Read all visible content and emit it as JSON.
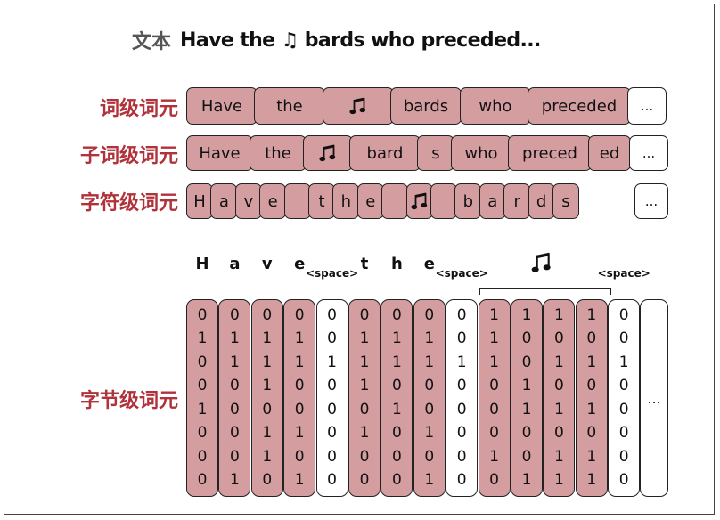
{
  "title": {
    "label": "文本",
    "text": "Have the ♫ bards who preceded..."
  },
  "colors": {
    "token_fill": "#d49ea1",
    "label_red": "#b0323a",
    "white": "#ffffff",
    "border": "#222222"
  },
  "rows": {
    "word": {
      "label": "词级词元",
      "tokens": [
        {
          "text": "Have"
        },
        {
          "text": "the"
        },
        {
          "text": "♫",
          "icon": "music-note-icon"
        },
        {
          "text": "bards"
        },
        {
          "text": "who"
        },
        {
          "text": "preceded"
        },
        {
          "text": "...",
          "white": true
        }
      ]
    },
    "subword": {
      "label": "子词级词元",
      "tokens": [
        {
          "text": "Have"
        },
        {
          "text": "the"
        },
        {
          "text": "♫",
          "icon": "music-note-icon"
        },
        {
          "text": "bard"
        },
        {
          "text": "s"
        },
        {
          "text": "who"
        },
        {
          "text": "preced"
        },
        {
          "text": "ed"
        },
        {
          "text": "...",
          "white": true
        }
      ]
    },
    "char": {
      "label": "字符级词元",
      "tokens": [
        {
          "text": "H"
        },
        {
          "text": "a"
        },
        {
          "text": "v"
        },
        {
          "text": "e"
        },
        {
          "text": ""
        },
        {
          "text": "t"
        },
        {
          "text": "h"
        },
        {
          "text": "e"
        },
        {
          "text": ""
        },
        {
          "text": "♫",
          "icon": "music-note-icon"
        },
        {
          "text": ""
        },
        {
          "text": "b"
        },
        {
          "text": "a"
        },
        {
          "text": "r"
        },
        {
          "text": "d"
        },
        {
          "text": "s"
        },
        {
          "text": "...",
          "white": true
        }
      ]
    },
    "byte": {
      "label": "字节级词元",
      "headers": [
        "H",
        "a",
        "v",
        "e",
        "<space>",
        "t",
        "h",
        "e",
        "<space>",
        "♫",
        "<space>"
      ],
      "columns": [
        {
          "bits": "01001000"
        },
        {
          "bits": "01100001"
        },
        {
          "bits": "01110110"
        },
        {
          "bits": "01100101"
        },
        {
          "bits": "00100000",
          "white": true
        },
        {
          "bits": "01110100"
        },
        {
          "bits": "01101000"
        },
        {
          "bits": "01100101"
        },
        {
          "bits": "00100000",
          "white": true
        },
        {
          "bits": "11100010"
        },
        {
          "bits": "10011001"
        },
        {
          "bits": "10101011"
        },
        {
          "bits": "10101011"
        },
        {
          "bits": "00100000",
          "white": true
        }
      ],
      "more": "..."
    }
  }
}
